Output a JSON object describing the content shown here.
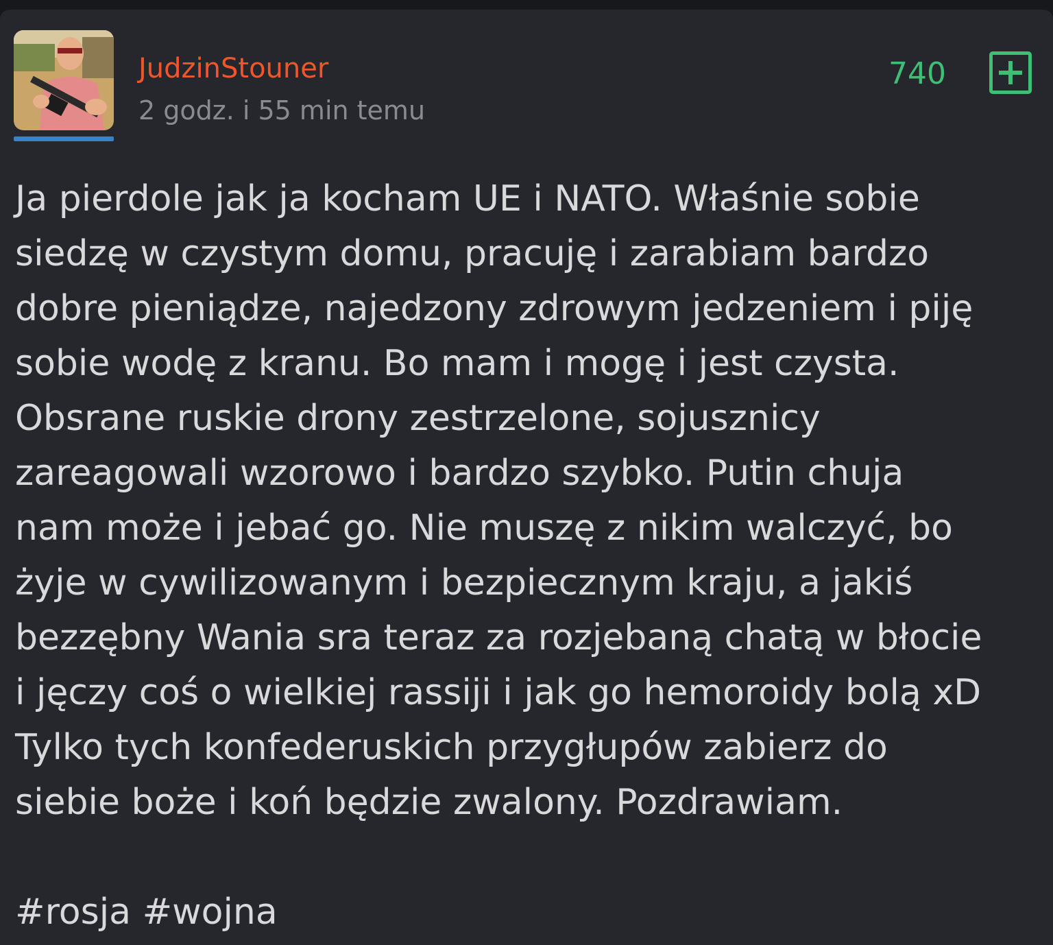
{
  "post": {
    "author": "JudzinStouner",
    "time_ago": "2 godz. i 55 min temu",
    "score": "740",
    "upvote_icon": "plus-square-icon",
    "body_lines": [
      "Ja pierdole jak ja kocham UE i NATO. Właśnie sobie",
      "siedzę w czystym domu, pracuję i zarabiam bardzo",
      "dobre pieniądze, najedzony zdrowym jedzeniem i piję",
      "sobie wodę z kranu. Bo mam i mogę i jest czysta.",
      "Obsrane ruskie drony zestrzelone, sojusznicy",
      "zareagowali wzorowo i bardzo szybko. Putin chuja",
      "nam może i jebać go. Nie muszę z nikim walczyć, bo",
      "żyje w cywilizowanym i bezpiecznym kraju, a jakiś",
      "bezzębny Wania sra teraz za rozjebaną chatą w błocie",
      "i jęczy coś o wielkiej rassiji i jak go hemoroidy bolą xD",
      "Tylko tych konfederuskich przygłupów zabierz do",
      "siebie boże i koń będzie zwalony. Pozdrawiam."
    ],
    "tags": [
      "#rosja",
      "#wojna"
    ]
  },
  "colors": {
    "background": "#26272d",
    "author": "#f0562a",
    "score": "#3fbf73",
    "text": "#d9d9dc",
    "meta": "#8a8b90",
    "avatar_underline": "#3b82c4"
  }
}
